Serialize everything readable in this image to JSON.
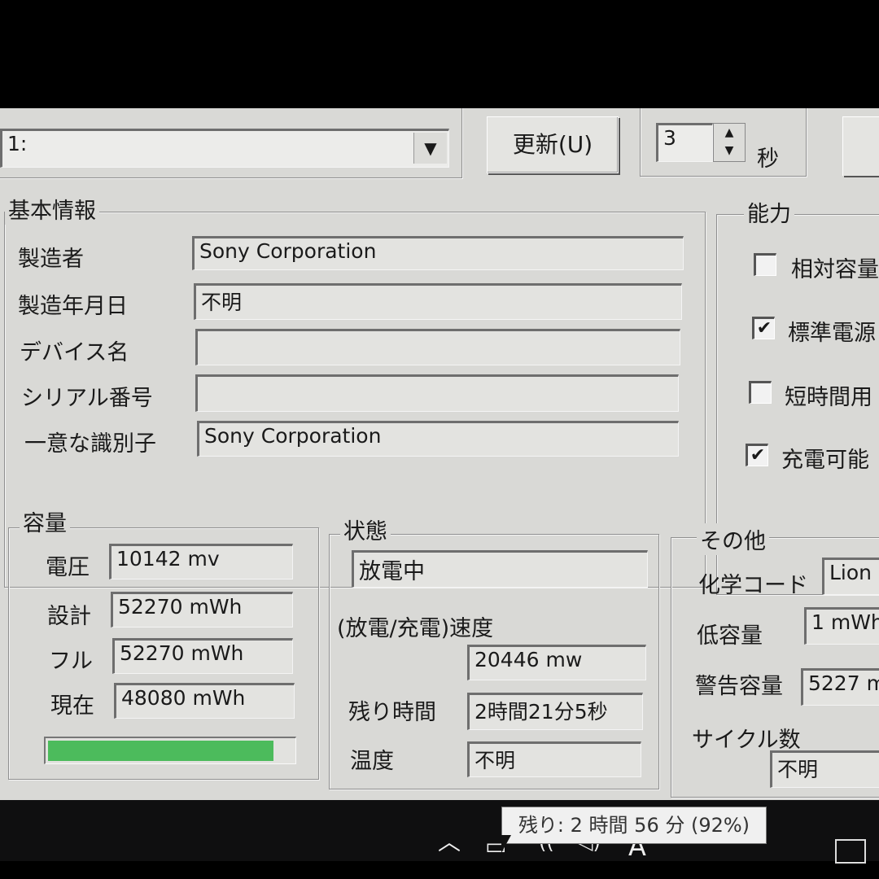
{
  "toolbar": {
    "battery_select_value": "1:",
    "refresh_button": "更新(U)",
    "interval_value": "3",
    "interval_unit": "秒"
  },
  "basic_info": {
    "legend": "基本情報",
    "rows": [
      {
        "label": "製造者",
        "value": "Sony Corporation"
      },
      {
        "label": "製造年月日",
        "value": "不明"
      },
      {
        "label": "デバイス名",
        "value": ""
      },
      {
        "label": "シリアル番号",
        "value": ""
      },
      {
        "label": "一意な識別子",
        "value": "Sony Corporation"
      }
    ]
  },
  "capability": {
    "legend": "能力",
    "items": [
      {
        "label": "相対容量",
        "checked": false
      },
      {
        "label": "標準電源",
        "checked": true
      },
      {
        "label": "短時間用",
        "checked": false
      },
      {
        "label": "充電可能",
        "checked": true
      }
    ]
  },
  "capacity": {
    "legend": "容量",
    "rows": [
      {
        "label": "電圧",
        "value": "10142 mv"
      },
      {
        "label": "設計",
        "value": "52270 mWh"
      },
      {
        "label": "フル",
        "value": "52270 mWh"
      },
      {
        "label": "現在",
        "value": "48080 mWh"
      }
    ],
    "charge_fraction": 0.92,
    "bar_color": "#4cbb5c"
  },
  "status": {
    "legend": "状態",
    "state_value": "放電中",
    "rate_label": "(放電/充電)速度",
    "rate_value": "20446 mw",
    "remaining_label": "残り時間",
    "remaining_value": "2時間21分5秒",
    "temp_label": "温度",
    "temp_value": "不明"
  },
  "other": {
    "legend": "その他",
    "chem_label": "化学コード",
    "chem_value": "Lion",
    "low_label": "低容量",
    "low_value": "1 mWh",
    "warn_label": "警告容量",
    "warn_value": "5227 m",
    "cycle_label": "サイクル数",
    "cycle_value": "不明"
  },
  "tooltip": {
    "text": "残り: 2 時間 56 分 (92%)"
  },
  "tray": {
    "ime_label": "A",
    "icons": [
      "chevron-up-icon",
      "battery-icon",
      "wifi-icon",
      "volume-icon",
      "notification-icon"
    ]
  }
}
